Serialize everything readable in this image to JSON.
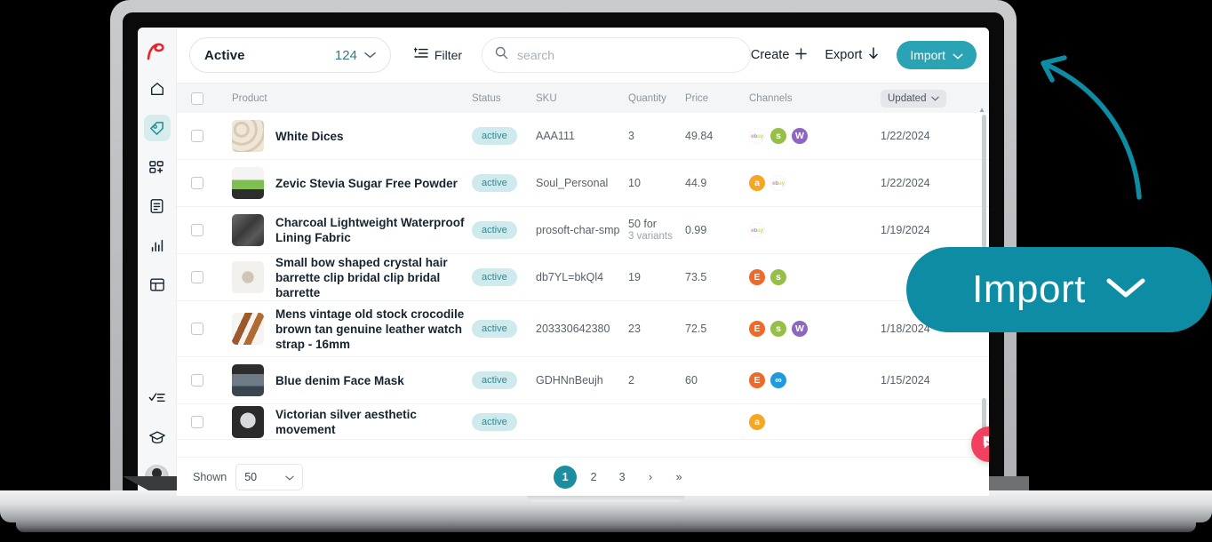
{
  "app": {
    "logo_icon": "swoosh-logo-icon"
  },
  "sidebar": {
    "items": [
      {
        "name": "home",
        "icon": "home-icon",
        "active": false
      },
      {
        "name": "products",
        "icon": "tag-icon",
        "active": true
      },
      {
        "name": "listings",
        "icon": "grid-plus-icon",
        "active": false
      },
      {
        "name": "orders",
        "icon": "document-icon",
        "active": false
      },
      {
        "name": "analytics",
        "icon": "bar-chart-icon",
        "active": false
      },
      {
        "name": "layout",
        "icon": "layout-icon",
        "active": false
      }
    ],
    "bottom_items": [
      {
        "name": "tasks",
        "icon": "checklist-icon"
      },
      {
        "name": "learn",
        "icon": "graduation-cap-icon"
      }
    ],
    "avatar": "user-avatar"
  },
  "toolbar": {
    "status_label": "Active",
    "status_count": "124",
    "filter_label": "Filter",
    "search_placeholder": "search",
    "search_value": "",
    "create_label": "Create",
    "export_label": "Export",
    "import_label": "Import"
  },
  "table": {
    "columns": {
      "product": "Product",
      "status": "Status",
      "sku": "SKU",
      "quantity": "Quantity",
      "price": "Price",
      "channels": "Channels",
      "updated": "Updated"
    },
    "rows": [
      {
        "product": "White Dices",
        "status": "active",
        "sku": "AAA111",
        "quantity": "3",
        "quantity_sub": "",
        "price": "49.84",
        "channels": [
          "ebay",
          "shop",
          "walmart"
        ],
        "updated": "1/22/2024",
        "thumb": "white-dices-thumbnail"
      },
      {
        "product": "Zevic Stevia Sugar Free Powder",
        "status": "active",
        "sku": "Soul_Personal",
        "quantity": "10",
        "quantity_sub": "",
        "price": "44.9",
        "channels": [
          "amazon",
          "ebay"
        ],
        "updated": "1/22/2024",
        "thumb": "zevic-powder-thumbnail"
      },
      {
        "product": "Charcoal Lightweight Waterproof Lining Fabric",
        "status": "active",
        "sku": "prosoft-char-smp",
        "quantity": "50 for",
        "quantity_sub": "3 variants",
        "price": "0.99",
        "channels": [
          "ebay"
        ],
        "updated": "1/19/2024",
        "thumb": "charcoal-fabric-thumbnail"
      },
      {
        "product": "Small bow shaped crystal hair barrette clip bridal clip bridal barrette",
        "status": "active",
        "sku": "db7YL=bkQl4",
        "quantity": "19",
        "quantity_sub": "",
        "price": "73.5",
        "channels": [
          "etsy",
          "shop"
        ],
        "updated": "",
        "thumb": "bow-barrette-thumbnail"
      },
      {
        "product": "Mens vintage old stock crocodile brown tan genuine leather watch strap - 16mm",
        "status": "active",
        "sku": "203330642380",
        "quantity": "23",
        "quantity_sub": "",
        "price": "72.5",
        "channels": [
          "etsy",
          "shop",
          "walmart"
        ],
        "updated": "1/18/2024",
        "thumb": "leather-strap-thumbnail"
      },
      {
        "product": "Blue denim Face Mask",
        "status": "active",
        "sku": "GDHNnBeujh",
        "quantity": "2",
        "quantity_sub": "",
        "price": "60",
        "channels": [
          "etsy",
          "meta"
        ],
        "updated": "1/15/2024",
        "thumb": "face-mask-thumbnail"
      },
      {
        "product": "Victorian silver aesthetic movement",
        "status": "active",
        "sku": "",
        "quantity": "",
        "quantity_sub": "",
        "price": "",
        "channels": [
          "amazon"
        ],
        "updated": "",
        "thumb": "victorian-silver-thumbnail"
      }
    ]
  },
  "footer": {
    "shown_label": "Shown",
    "shown_value": "50",
    "pages": [
      "1",
      "2",
      "3"
    ],
    "active_page": "1",
    "next_label": "›",
    "last_label": "»"
  },
  "callout": {
    "label": "Import",
    "icon": "chevron-down-icon"
  },
  "colors": {
    "accent_teal": "#2aa3b4",
    "callout_teal": "#0e8ca3",
    "badge_bg": "#cfeaec",
    "badge_text": "#2e8a95",
    "pager_active": "#1b8f9f",
    "chat_pink": "#f2415f"
  }
}
